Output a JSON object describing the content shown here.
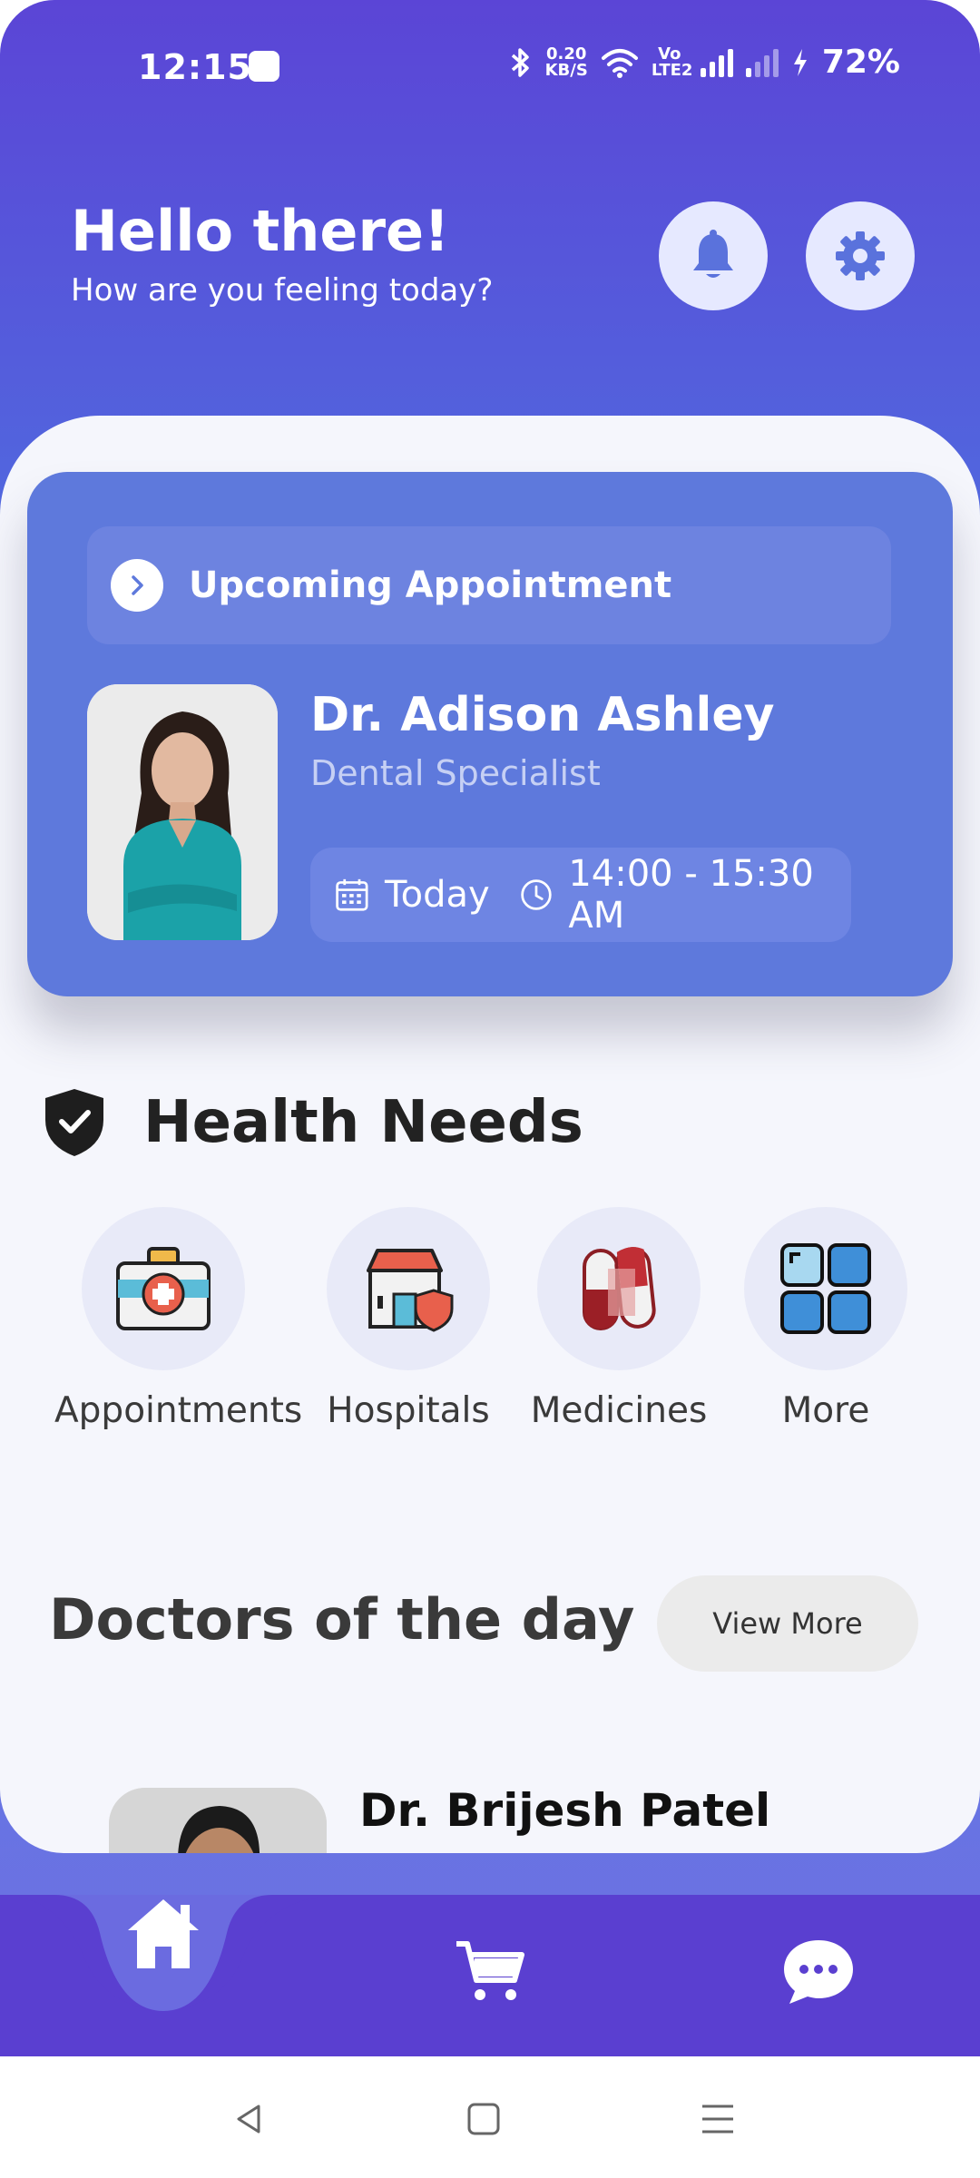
{
  "status_bar": {
    "time": "12:15",
    "net_speed_value": "0.20",
    "net_speed_unit": "KB/S",
    "volte": "Vo LTE2",
    "battery": "72%"
  },
  "header": {
    "title": "Hello there!",
    "subtitle": "How are you feeling today?"
  },
  "appointment": {
    "section_label": "Upcoming Appointment",
    "doctor_name": "Dr. Adison Ashley",
    "specialty": "Dental Specialist",
    "day": "Today",
    "time_range": "14:00 - 15:30 AM"
  },
  "health_needs": {
    "title": "Health Needs",
    "items": [
      {
        "label": "Appointments",
        "icon": "first-aid-kit-icon"
      },
      {
        "label": "Hospitals",
        "icon": "hospital-icon"
      },
      {
        "label": "Medicines",
        "icon": "pills-icon"
      },
      {
        "label": "More",
        "icon": "grid-icon"
      }
    ]
  },
  "doctors_of_day": {
    "title": "Doctors of the day",
    "view_more": "View More",
    "first_doctor_name": "Dr. Brijesh Patel"
  },
  "bottom_nav": {
    "items": [
      "home-icon",
      "cart-icon",
      "chat-icon"
    ]
  },
  "colors": {
    "primary": "#5a3fd0",
    "card": "#5e79dc",
    "accent_red": "#e8604c"
  }
}
